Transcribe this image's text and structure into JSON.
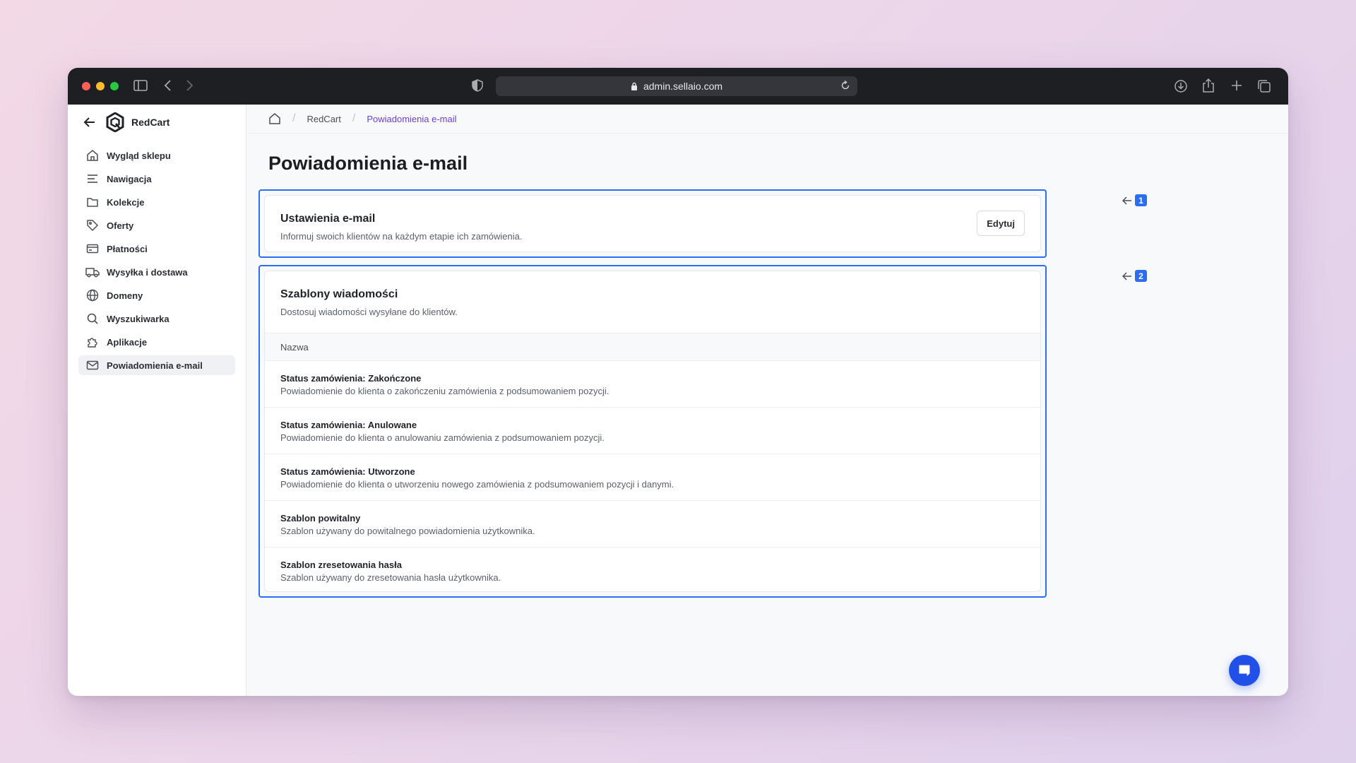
{
  "browser": {
    "url": "admin.sellaio.com"
  },
  "sidebar": {
    "brand": "RedCart",
    "items": [
      {
        "label": "Wygląd sklepu",
        "icon": "home-icon"
      },
      {
        "label": "Nawigacja",
        "icon": "menu-lines-icon"
      },
      {
        "label": "Kolekcje",
        "icon": "folder-icon"
      },
      {
        "label": "Oferty",
        "icon": "tag-icon"
      },
      {
        "label": "Płatności",
        "icon": "credit-card-icon"
      },
      {
        "label": "Wysyłka i dostawa",
        "icon": "truck-icon"
      },
      {
        "label": "Domeny",
        "icon": "globe-icon"
      },
      {
        "label": "Wyszukiwarka",
        "icon": "search-icon"
      },
      {
        "label": "Aplikacje",
        "icon": "puzzle-icon"
      },
      {
        "label": "Powiadomienia e-mail",
        "icon": "mail-icon",
        "active": true
      }
    ]
  },
  "breadcrumb": {
    "store": "RedCart",
    "current": "Powiadomienia e-mail"
  },
  "page": {
    "title": "Powiadomienia e-mail"
  },
  "settings_card": {
    "title": "Ustawienia e-mail",
    "subtitle": "Informuj swoich klientów na każdym etapie ich zamówienia.",
    "edit_label": "Edytuj"
  },
  "templates_card": {
    "title": "Szablony wiadomości",
    "subtitle": "Dostosuj wiadomości wysyłane do klientów.",
    "column_name": "Nazwa",
    "rows": [
      {
        "name": "Status zamówienia: Zakończone",
        "desc": "Powiadomienie do klienta o zakończeniu zamówienia z podsumowaniem pozycji."
      },
      {
        "name": "Status zamówienia: Anulowane",
        "desc": "Powiadomienie do klienta o anulowaniu zamówienia z podsumowaniem pozycji."
      },
      {
        "name": "Status zamówienia: Utworzone",
        "desc": "Powiadomienie do klienta o utworzeniu nowego zamówienia z podsumowaniem pozycji i danymi."
      },
      {
        "name": "Szablon powitalny",
        "desc": "Szablon używany do powitalnego powiadomienia użytkownika."
      },
      {
        "name": "Szablon zresetowania hasła",
        "desc": "Szablon używany do zresetowania hasła użytkownika."
      }
    ]
  },
  "annotations": {
    "marker1": "1",
    "marker2": "2"
  },
  "colors": {
    "accent": "#2b6ef3",
    "breadcrumb_active": "#6d3fd8",
    "chat_button": "#2150e8"
  }
}
